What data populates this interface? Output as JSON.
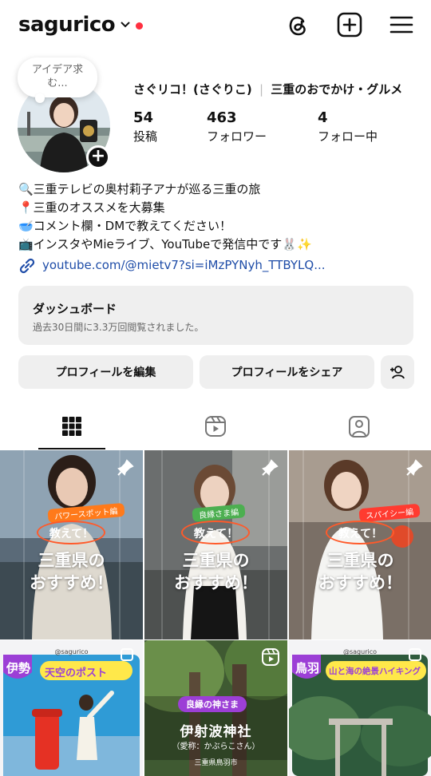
{
  "header": {
    "username": "sagurico",
    "icons": [
      "threads-icon",
      "new-post-icon",
      "menu-icon"
    ],
    "notification_color": "#ff3040"
  },
  "profile": {
    "note": "アイデア求む...",
    "full_name": "さぐリコ！(さぐりこ)",
    "category": "三重のおでかけ・グルメ",
    "stats": [
      {
        "value": "54",
        "label": "投稿"
      },
      {
        "value": "463",
        "label": "フォロワー"
      },
      {
        "value": "4",
        "label": "フォロー中"
      }
    ],
    "bio": [
      "🔍三重テレビの奥村莉子アナが巡る三重の旅",
      "📍三重のオススメを大募集",
      "🥣コメント欄・DMで教えてください！",
      "📺インスタやMieライブ、YouTubeで発信中です🐰✨"
    ],
    "link": "youtube.com/@mietv7?si=iMzPYNyh_TTBYLQ..."
  },
  "dashboard": {
    "title": "ダッシュボード",
    "subtitle": "過去30日間に3.3万回閲覧されました。"
  },
  "buttons": {
    "edit": "プロフィールを編集",
    "share": "プロフィールをシェア"
  },
  "tabs": [
    "posts-grid-tab",
    "reels-tab",
    "tagged-tab"
  ],
  "posts": [
    {
      "tag": "パワースポット編",
      "tag_color": "#ff7a1a",
      "ask": "教えて！",
      "line1": "三重県の",
      "line2": "おすすめ！"
    },
    {
      "tag": "良縁さま編",
      "tag_color": "#4caf50",
      "ask": "教えて！",
      "line1": "三重県の",
      "line2": "おすすめ！"
    },
    {
      "tag": "スパイシー編",
      "tag_color": "#ff3b30",
      "ask": "教えて！",
      "line1": "三重県の",
      "line2": "おすすめ！"
    }
  ],
  "posts_row2": [
    {
      "handle": "@sagurico",
      "place": "伊勢",
      "title": "天空のポスト"
    },
    {
      "badge": "良縁の神さま",
      "title": "伊射波神社",
      "reading": "（愛称：かぶらこさん）",
      "location": "三重県鳥羽市"
    },
    {
      "handle": "@sagurico",
      "place": "鳥羽",
      "title": "山と海の絶景ハイキング"
    }
  ]
}
